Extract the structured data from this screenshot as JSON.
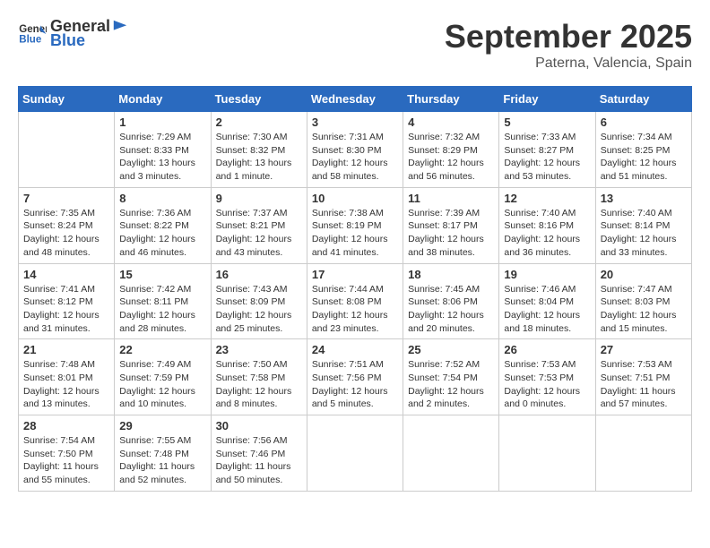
{
  "header": {
    "logo_general": "General",
    "logo_blue": "Blue",
    "month_title": "September 2025",
    "location": "Paterna, Valencia, Spain"
  },
  "calendar": {
    "weekdays": [
      "Sunday",
      "Monday",
      "Tuesday",
      "Wednesday",
      "Thursday",
      "Friday",
      "Saturday"
    ],
    "weeks": [
      [
        {
          "day": "",
          "info": ""
        },
        {
          "day": "1",
          "info": "Sunrise: 7:29 AM\nSunset: 8:33 PM\nDaylight: 13 hours\nand 3 minutes."
        },
        {
          "day": "2",
          "info": "Sunrise: 7:30 AM\nSunset: 8:32 PM\nDaylight: 13 hours\nand 1 minute."
        },
        {
          "day": "3",
          "info": "Sunrise: 7:31 AM\nSunset: 8:30 PM\nDaylight: 12 hours\nand 58 minutes."
        },
        {
          "day": "4",
          "info": "Sunrise: 7:32 AM\nSunset: 8:29 PM\nDaylight: 12 hours\nand 56 minutes."
        },
        {
          "day": "5",
          "info": "Sunrise: 7:33 AM\nSunset: 8:27 PM\nDaylight: 12 hours\nand 53 minutes."
        },
        {
          "day": "6",
          "info": "Sunrise: 7:34 AM\nSunset: 8:25 PM\nDaylight: 12 hours\nand 51 minutes."
        }
      ],
      [
        {
          "day": "7",
          "info": "Sunrise: 7:35 AM\nSunset: 8:24 PM\nDaylight: 12 hours\nand 48 minutes."
        },
        {
          "day": "8",
          "info": "Sunrise: 7:36 AM\nSunset: 8:22 PM\nDaylight: 12 hours\nand 46 minutes."
        },
        {
          "day": "9",
          "info": "Sunrise: 7:37 AM\nSunset: 8:21 PM\nDaylight: 12 hours\nand 43 minutes."
        },
        {
          "day": "10",
          "info": "Sunrise: 7:38 AM\nSunset: 8:19 PM\nDaylight: 12 hours\nand 41 minutes."
        },
        {
          "day": "11",
          "info": "Sunrise: 7:39 AM\nSunset: 8:17 PM\nDaylight: 12 hours\nand 38 minutes."
        },
        {
          "day": "12",
          "info": "Sunrise: 7:40 AM\nSunset: 8:16 PM\nDaylight: 12 hours\nand 36 minutes."
        },
        {
          "day": "13",
          "info": "Sunrise: 7:40 AM\nSunset: 8:14 PM\nDaylight: 12 hours\nand 33 minutes."
        }
      ],
      [
        {
          "day": "14",
          "info": "Sunrise: 7:41 AM\nSunset: 8:12 PM\nDaylight: 12 hours\nand 31 minutes."
        },
        {
          "day": "15",
          "info": "Sunrise: 7:42 AM\nSunset: 8:11 PM\nDaylight: 12 hours\nand 28 minutes."
        },
        {
          "day": "16",
          "info": "Sunrise: 7:43 AM\nSunset: 8:09 PM\nDaylight: 12 hours\nand 25 minutes."
        },
        {
          "day": "17",
          "info": "Sunrise: 7:44 AM\nSunset: 8:08 PM\nDaylight: 12 hours\nand 23 minutes."
        },
        {
          "day": "18",
          "info": "Sunrise: 7:45 AM\nSunset: 8:06 PM\nDaylight: 12 hours\nand 20 minutes."
        },
        {
          "day": "19",
          "info": "Sunrise: 7:46 AM\nSunset: 8:04 PM\nDaylight: 12 hours\nand 18 minutes."
        },
        {
          "day": "20",
          "info": "Sunrise: 7:47 AM\nSunset: 8:03 PM\nDaylight: 12 hours\nand 15 minutes."
        }
      ],
      [
        {
          "day": "21",
          "info": "Sunrise: 7:48 AM\nSunset: 8:01 PM\nDaylight: 12 hours\nand 13 minutes."
        },
        {
          "day": "22",
          "info": "Sunrise: 7:49 AM\nSunset: 7:59 PM\nDaylight: 12 hours\nand 10 minutes."
        },
        {
          "day": "23",
          "info": "Sunrise: 7:50 AM\nSunset: 7:58 PM\nDaylight: 12 hours\nand 8 minutes."
        },
        {
          "day": "24",
          "info": "Sunrise: 7:51 AM\nSunset: 7:56 PM\nDaylight: 12 hours\nand 5 minutes."
        },
        {
          "day": "25",
          "info": "Sunrise: 7:52 AM\nSunset: 7:54 PM\nDaylight: 12 hours\nand 2 minutes."
        },
        {
          "day": "26",
          "info": "Sunrise: 7:53 AM\nSunset: 7:53 PM\nDaylight: 12 hours\nand 0 minutes."
        },
        {
          "day": "27",
          "info": "Sunrise: 7:53 AM\nSunset: 7:51 PM\nDaylight: 11 hours\nand 57 minutes."
        }
      ],
      [
        {
          "day": "28",
          "info": "Sunrise: 7:54 AM\nSunset: 7:50 PM\nDaylight: 11 hours\nand 55 minutes."
        },
        {
          "day": "29",
          "info": "Sunrise: 7:55 AM\nSunset: 7:48 PM\nDaylight: 11 hours\nand 52 minutes."
        },
        {
          "day": "30",
          "info": "Sunrise: 7:56 AM\nSunset: 7:46 PM\nDaylight: 11 hours\nand 50 minutes."
        },
        {
          "day": "",
          "info": ""
        },
        {
          "day": "",
          "info": ""
        },
        {
          "day": "",
          "info": ""
        },
        {
          "day": "",
          "info": ""
        }
      ]
    ]
  }
}
